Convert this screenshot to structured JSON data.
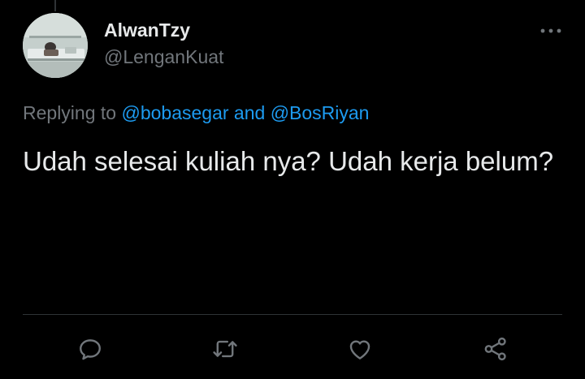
{
  "tweet": {
    "author": {
      "display_name": "AlwanTzy",
      "handle": "@LenganKuat"
    },
    "reply_context": {
      "prefix": "Replying to ",
      "mentions": [
        "@bobasegar",
        "@BosRiyan"
      ],
      "joiner": " and "
    },
    "text": "Udah selesai kuliah nya? Udah kerja belum?",
    "actions": [
      {
        "name": "reply",
        "icon": "reply-icon"
      },
      {
        "name": "retweet",
        "icon": "retweet-icon"
      },
      {
        "name": "like",
        "icon": "heart-icon"
      },
      {
        "name": "share",
        "icon": "share-icon"
      }
    ],
    "more_icon": "more-dots-icon"
  },
  "colors": {
    "background": "#000000",
    "primary_text": "#e7e9ea",
    "secondary_text": "#71767b",
    "link": "#1d9bf0",
    "divider": "#2f3336"
  }
}
